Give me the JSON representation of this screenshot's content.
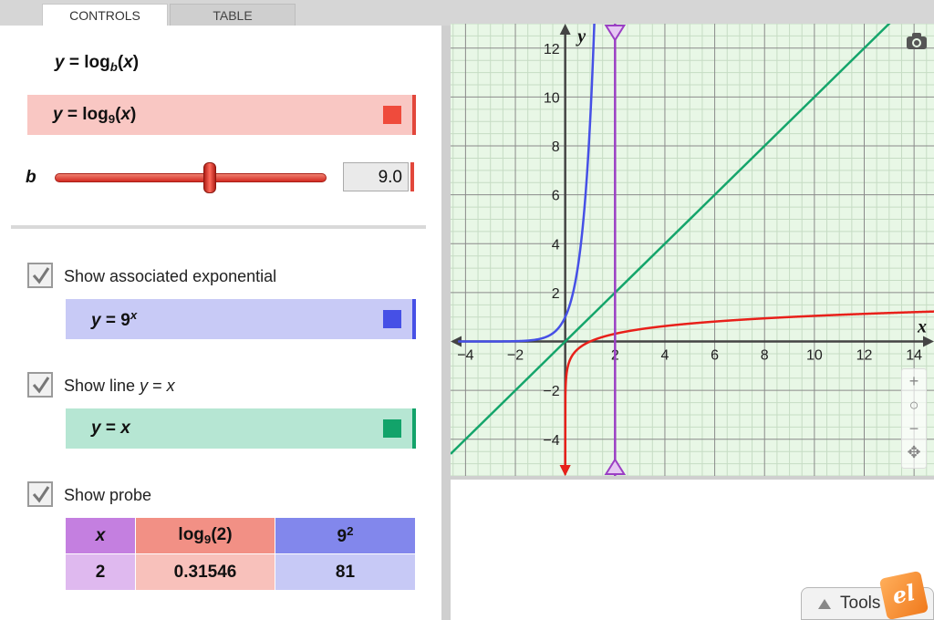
{
  "tabs": [
    {
      "label": "CONTROLS",
      "active": true
    },
    {
      "label": "TABLE",
      "active": false
    }
  ],
  "controls": {
    "heading": {
      "y": "y",
      "eq": " = log",
      "base": "b",
      "open": "(",
      "x": "x",
      "close": ")"
    },
    "log_eq": {
      "y": "y",
      "eq": " = log",
      "base": "9",
      "open": "(",
      "x": "x",
      "close": ")",
      "color": "#ef4b3c"
    },
    "slider": {
      "label": "b",
      "value": "9.0",
      "fraction": 0.57
    },
    "exp": {
      "checkbox_label": "Show associated exponential",
      "checked": true,
      "y": "y",
      "eq": " = 9",
      "exp": "x",
      "color": "#4650e6"
    },
    "line": {
      "checkbox_label_prefix": "Show line ",
      "cl_y": "y",
      "cl_eq": " = ",
      "cl_x": "x",
      "checked": true,
      "y": "y",
      "eq": " = ",
      "x": "x",
      "color": "#12a36a"
    },
    "probe": {
      "checkbox_label": "Show probe",
      "checked": true,
      "header": {
        "x": "x",
        "log_pre": "log",
        "log_base": "9",
        "log_arg": "(2)",
        "pow_base": "9",
        "pow_exp": "2"
      },
      "values": {
        "x": "2",
        "log": "0.31546",
        "pow": "81"
      }
    }
  },
  "graph": {
    "x_axis_label": "x",
    "y_axis_label": "y",
    "x_range": [
      -4.6,
      14.8
    ],
    "y_range": [
      -5.5,
      13.0
    ],
    "x_ticks": [
      -4,
      -2,
      2,
      4,
      6,
      8,
      10,
      12,
      14
    ],
    "y_ticks": [
      -4,
      -2,
      2,
      4,
      6,
      8,
      10,
      12
    ],
    "probe_x": 2,
    "base": 9,
    "colors": {
      "log": "#e8201a",
      "exp": "#4650e6",
      "line": "#15a56b",
      "probe": "#9b3fc4",
      "grid_major": "#8a8a8a",
      "grid_minor": "#c6dcc4"
    }
  },
  "zoom": {
    "plus": "+",
    "reset": "○",
    "minus": "−",
    "pan": "✥"
  },
  "tools_label": "Tools",
  "logo_text": "el"
}
